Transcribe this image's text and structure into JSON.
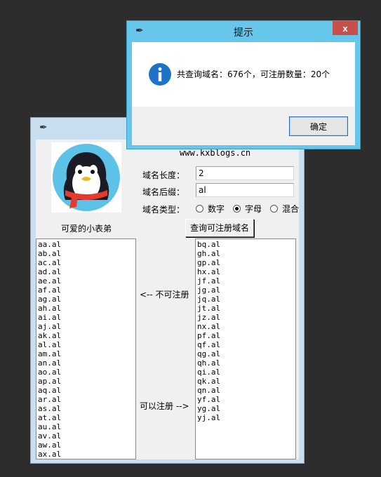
{
  "main_window": {
    "title_icon": "feather-icon",
    "avatar_name": "可爱的小表弟",
    "site_url": "www.kxblogs.cn",
    "length_label": "域名长度：",
    "length_value": "2",
    "suffix_label": "域名后缀：",
    "suffix_value": "al",
    "type_label": "域名类型：",
    "type_options": [
      "数字",
      "字母",
      "混合"
    ],
    "type_selected": "字母",
    "query_button": "查询可注册域名",
    "unavailable_label": "<-- 不可注册",
    "available_label": "可以注册 -->",
    "unavailable_list": [
      "aa.al",
      "ab.al",
      "ac.al",
      "ad.al",
      "ae.al",
      "af.al",
      "ag.al",
      "ah.al",
      "ai.al",
      "aj.al",
      "ak.al",
      "al.al",
      "am.al",
      "an.al",
      "ao.al",
      "ap.al",
      "aq.al",
      "ar.al",
      "as.al",
      "at.al",
      "au.al",
      "av.al",
      "aw.al",
      "ax.al"
    ],
    "available_list": [
      "bq.al",
      "gh.al",
      "gp.al",
      "hx.al",
      "jf.al",
      "jg.al",
      "jq.al",
      "jt.al",
      "jz.al",
      "nx.al",
      "pf.al",
      "qf.al",
      "qg.al",
      "qh.al",
      "qi.al",
      "qk.al",
      "qn.al",
      "yf.al",
      "yg.al",
      "yj.al"
    ]
  },
  "dialog": {
    "title": "提示",
    "close_label": "x",
    "message": "共查询域名：676个，可注册数量：20个",
    "ok_button": "确定"
  },
  "colors": {
    "dialog_titlebar": "#67c6ec",
    "close_button": "#c7504b",
    "info_icon": "#1e73c8"
  }
}
